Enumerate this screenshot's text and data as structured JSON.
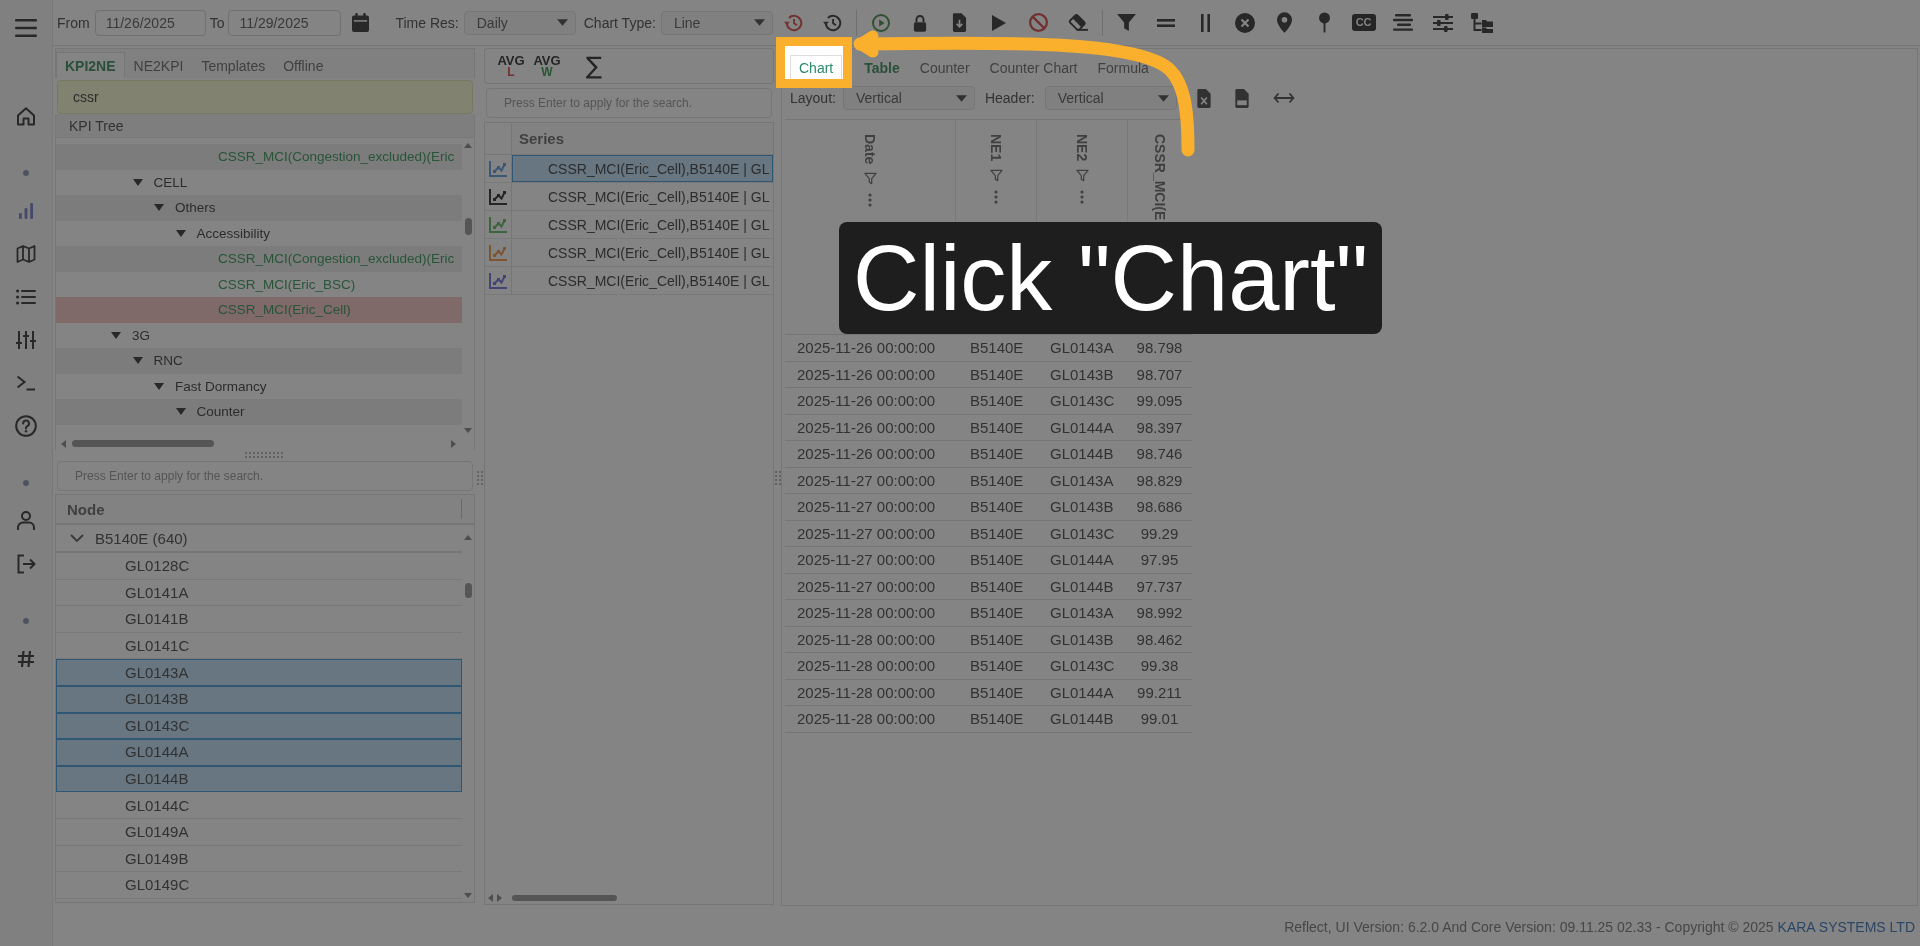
{
  "nav_rail": {
    "groups": [
      [
        {
          "kind": "home",
          "selected": false
        }
      ],
      [
        {
          "kind": "chart",
          "selected": true
        },
        {
          "kind": "map",
          "selected": false
        },
        {
          "kind": "list",
          "selected": false
        },
        {
          "kind": "sliders",
          "selected": false
        },
        {
          "kind": "terminal",
          "selected": false
        },
        {
          "kind": "help",
          "selected": false
        }
      ],
      [
        {
          "kind": "user",
          "selected": false
        },
        {
          "kind": "logout",
          "selected": false
        }
      ],
      [
        {
          "kind": "hash",
          "selected": false
        }
      ]
    ]
  },
  "toolbar": {
    "from": {
      "label": "From",
      "value": "11/26/2025"
    },
    "to": {
      "label": "To",
      "value": "11/29/2025"
    },
    "time_res": {
      "label": "Time Res:",
      "value": "Daily"
    },
    "chart_type": {
      "label": "Chart Type:",
      "value": "Line"
    },
    "captions_button": "CC"
  },
  "kpi_panel": {
    "tabs": [
      {
        "label": "KPI2NE",
        "selected": true
      },
      {
        "label": "NE2KPI",
        "selected": false
      },
      {
        "label": "Templates",
        "selected": false
      },
      {
        "label": "Offline",
        "selected": false
      }
    ],
    "search": {
      "value": "cssr"
    },
    "tree_header": "KPI Tree",
    "tree": [
      {
        "children": [
          {
            "children": [
              {
                "children": [
                  {
                    "children": [
                      {
                        "kind": "kpi",
                        "label": "CSSR_MCI(Congestion_excluded)(Eric",
                        "selected": false
                      }
                    ]
                  }
                ]
              }
            ]
          },
          {
            "kind": "folder",
            "label": "CELL",
            "expanded": true,
            "selected": false,
            "children": [
              {
                "kind": "folder",
                "label": "Others",
                "expanded": true,
                "selected": false,
                "children": [
                  {
                    "kind": "folder",
                    "label": "Accessibility",
                    "expanded": true,
                    "selected": false,
                    "children": [
                      {
                        "kind": "kpi",
                        "label": "CSSR_MCI(Congestion_excluded)(Eric",
                        "selected": false
                      },
                      {
                        "kind": "kpi",
                        "label": "CSSR_MCI(Eric_BSC)",
                        "selected": false
                      },
                      {
                        "kind": "kpi",
                        "label": "CSSR_MCI(Eric_Cell)",
                        "selected": true
                      }
                    ]
                  }
                ]
              }
            ]
          }
        ]
      },
      {
        "kind": "folder",
        "label": "3G",
        "expanded": true,
        "selected": false,
        "children": [
          {
            "kind": "folder",
            "label": "RNC",
            "expanded": true,
            "selected": false,
            "children": [
              {
                "kind": "folder",
                "label": "Fast Dormancy",
                "expanded": true,
                "selected": false,
                "children": [
                  {
                    "kind": "folder",
                    "label": "Counter",
                    "expanded": true,
                    "selected": false
                  }
                ]
              }
            ]
          }
        ]
      }
    ]
  },
  "node_panel": {
    "search": {
      "placeholder": "Press Enter to apply for the search."
    },
    "column": "Node",
    "groups": [
      {
        "label": "B5140E (640)",
        "expanded": true,
        "selected": false,
        "children": [
          {
            "label": "GL0128C",
            "selected": false
          },
          {
            "label": "GL0141A",
            "selected": false
          },
          {
            "label": "GL0141B",
            "selected": false
          },
          {
            "label": "GL0141C",
            "selected": false
          },
          {
            "label": "GL0143A",
            "selected": true
          },
          {
            "label": "GL0143B",
            "selected": true
          },
          {
            "label": "GL0143C",
            "selected": true
          },
          {
            "label": "GL0144A",
            "selected": true
          },
          {
            "label": "GL0144B",
            "selected": true
          },
          {
            "label": "GL0144C",
            "selected": false
          },
          {
            "label": "GL0149A",
            "selected": false
          },
          {
            "label": "GL0149B",
            "selected": false
          },
          {
            "label": "GL0149C",
            "selected": false
          }
        ]
      }
    ]
  },
  "series_panel": {
    "tools": [
      {
        "kind": "average",
        "label": "AVG",
        "sub": "L",
        "color": "#723131"
      },
      {
        "kind": "average",
        "label": "AVG",
        "sub": "W",
        "color": "#295535"
      },
      {
        "kind": "sum",
        "label": "∑"
      }
    ],
    "search": {
      "placeholder": "Press Enter to apply for the search."
    },
    "column": "Series",
    "rows": [
      {
        "label": "CSSR_MCI(Eric_Cell),B5140E | GL",
        "color": "#3c5776",
        "selected": true
      },
      {
        "label": "CSSR_MCI(Eric_Cell),B5140E | GL",
        "color": "#252525",
        "selected": false
      },
      {
        "label": "CSSR_MCI(Eric_Cell),B5140E | GL",
        "color": "#3c643e",
        "selected": false
      },
      {
        "label": "CSSR_MCI(Eric_Cell),B5140E | GL",
        "color": "#7e5531",
        "selected": false
      },
      {
        "label": "CSSR_MCI(Eric_Cell),B5140E | GL",
        "color": "#424574",
        "selected": false
      }
    ]
  },
  "result_panel": {
    "tabs": [
      {
        "label": "Chart",
        "selected": false,
        "highlighted": true
      },
      {
        "label": "Table",
        "selected": true,
        "highlighted": false
      },
      {
        "label": "Counter",
        "selected": false,
        "highlighted": false
      },
      {
        "label": "Counter Chart",
        "selected": false,
        "highlighted": false
      },
      {
        "label": "Formula",
        "selected": false,
        "highlighted": false
      }
    ],
    "layout": {
      "label": "Layout:",
      "value": "Vertical"
    },
    "header": {
      "label": "Header:",
      "value": "Vertical"
    },
    "table": {
      "columns": [
        {
          "label": "Date",
          "icons": true
        },
        {
          "label": "NE1",
          "icons": true
        },
        {
          "label": "NE2",
          "icons": true
        },
        {
          "label": "CSSR_MCI(E",
          "icons": false
        }
      ],
      "rows": [
        [
          "2025-11-26 00:00:00",
          "B5140E",
          "GL0143A",
          "98.798"
        ],
        [
          "2025-11-26 00:00:00",
          "B5140E",
          "GL0143B",
          "98.707"
        ],
        [
          "2025-11-26 00:00:00",
          "B5140E",
          "GL0143C",
          "99.095"
        ],
        [
          "2025-11-26 00:00:00",
          "B5140E",
          "GL0144A",
          "98.397"
        ],
        [
          "2025-11-26 00:00:00",
          "B5140E",
          "GL0144B",
          "98.746"
        ],
        [
          "2025-11-27 00:00:00",
          "B5140E",
          "GL0143A",
          "98.829"
        ],
        [
          "2025-11-27 00:00:00",
          "B5140E",
          "GL0143B",
          "98.686"
        ],
        [
          "2025-11-27 00:00:00",
          "B5140E",
          "GL0143C",
          "99.29"
        ],
        [
          "2025-11-27 00:00:00",
          "B5140E",
          "GL0144A",
          "97.95"
        ],
        [
          "2025-11-27 00:00:00",
          "B5140E",
          "GL0144B",
          "97.737"
        ],
        [
          "2025-11-28 00:00:00",
          "B5140E",
          "GL0143A",
          "98.992"
        ],
        [
          "2025-11-28 00:00:00",
          "B5140E",
          "GL0143B",
          "98.462"
        ],
        [
          "2025-11-28 00:00:00",
          "B5140E",
          "GL0143C",
          "99.38"
        ],
        [
          "2025-11-28 00:00:00",
          "B5140E",
          "GL0144A",
          "99.211"
        ],
        [
          "2025-11-28 00:00:00",
          "B5140E",
          "GL0144B",
          "99.01"
        ]
      ]
    }
  },
  "tutorial": {
    "callout": "Click \"Chart\""
  },
  "footer": {
    "text": "Reflect, UI Version: 6.2.0 And Core Version: 09.11.25 02.33 - Copyright © 2025",
    "link": "KARA SYSTEMS LTD"
  }
}
